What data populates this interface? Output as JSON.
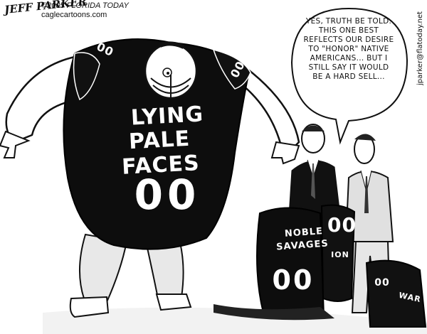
{
  "credits": {
    "signature": "JEFF PARKER",
    "copyright": "©2005 FLORIDA TODAY",
    "site": "caglecartoons.com",
    "email": "jparker@flatoday.net"
  },
  "speech_bubble": {
    "text": "YES, TRUTH BE TOLD. THIS ONE BEST REFLECTS OUR DESIRE TO \"HONOR\" NATIVE AMERICANS... BUT I STILL SAY IT WOULD BE A HARD SELL..."
  },
  "main_jersey": {
    "line1": "LYING",
    "line2": "PALE FACES",
    "number": "00",
    "shoulder_number": "00"
  },
  "held_jersey": {
    "line1": "NOBLE",
    "line2": "SAVAGES",
    "number": "00"
  },
  "back_jersey": {
    "number": "00",
    "word": "ION"
  },
  "right_jersey": {
    "number": "00",
    "word": "WAR"
  }
}
